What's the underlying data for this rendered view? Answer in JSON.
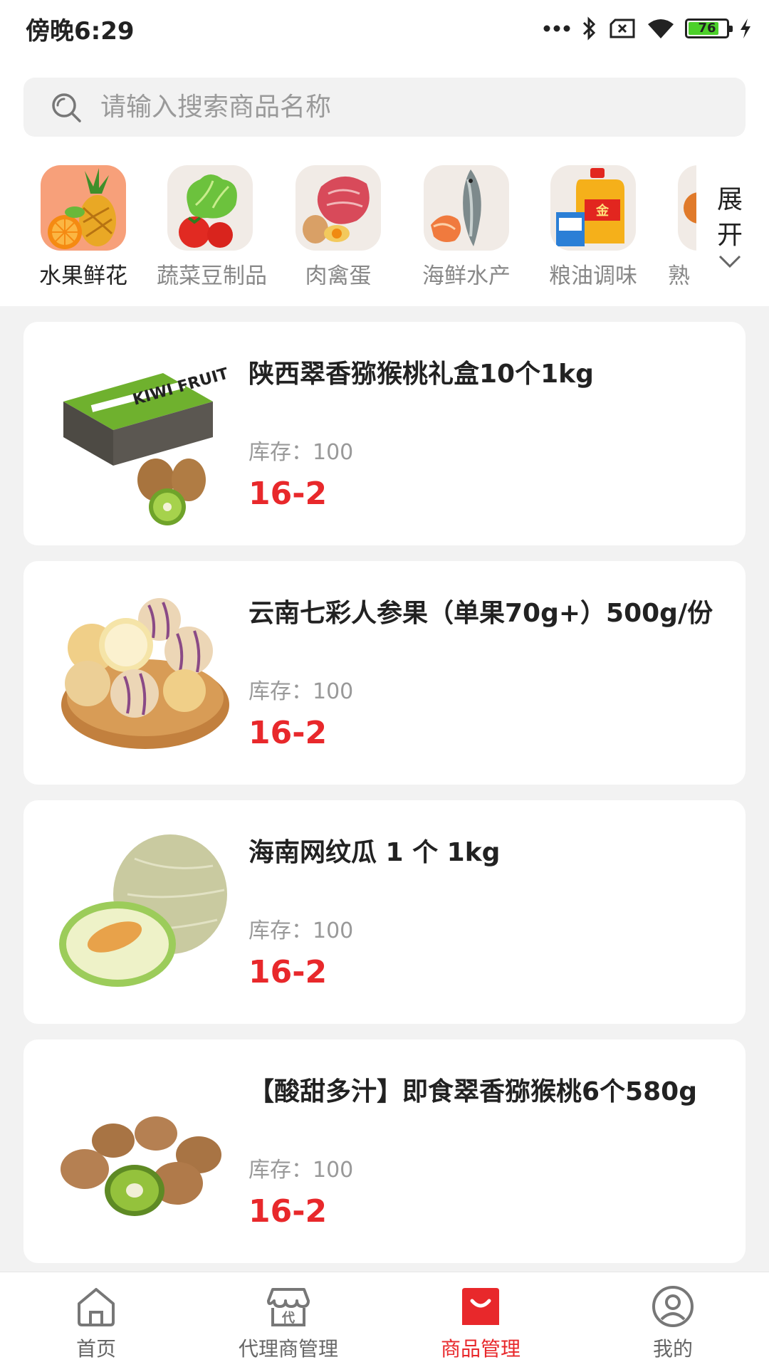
{
  "status_bar": {
    "time": "傍晚6:29",
    "battery": "76"
  },
  "search": {
    "placeholder": "请输入搜索商品名称"
  },
  "categories": [
    {
      "label": "水果鲜花",
      "icon": "fruit-icon",
      "active": true
    },
    {
      "label": "蔬菜豆制品",
      "icon": "vegetable-icon",
      "active": false
    },
    {
      "label": "肉禽蛋",
      "icon": "meat-icon",
      "active": false
    },
    {
      "label": "海鲜水产",
      "icon": "seafood-icon",
      "active": false
    },
    {
      "label": "粮油调味",
      "icon": "grain-oil-icon",
      "active": false
    },
    {
      "label": "熟",
      "icon": "cooked-food-icon",
      "active": false
    }
  ],
  "expand": {
    "line1": "展",
    "line2": "开"
  },
  "products": [
    {
      "name": "陕西翠香猕猴桃礼盒10个1kg",
      "stock": "库存：100",
      "price": "16-2",
      "image": "kiwi-box-image"
    },
    {
      "name": "云南七彩人参果（单果70g+）500g/份",
      "stock": "库存：100",
      "price": "16-2",
      "image": "pepino-image"
    },
    {
      "name": "海南网纹瓜 1 个 1kg",
      "stock": "库存：100",
      "price": "16-2",
      "image": "melon-image"
    },
    {
      "name": "【酸甜多汁】即食翠香猕猴桃6个580g",
      "stock": "库存：100",
      "price": "16-2",
      "image": "kiwi-image"
    }
  ],
  "tabbar": [
    {
      "label": "首页",
      "icon": "home-icon",
      "active": false
    },
    {
      "label": "代理商管理",
      "icon": "agent-store-icon",
      "active": false
    },
    {
      "label": "商品管理",
      "icon": "shopping-bag-icon",
      "active": true
    },
    {
      "label": "我的",
      "icon": "user-icon",
      "active": false
    }
  ],
  "colors": {
    "accent": "#e8282b",
    "background": "#f2f2f2"
  }
}
